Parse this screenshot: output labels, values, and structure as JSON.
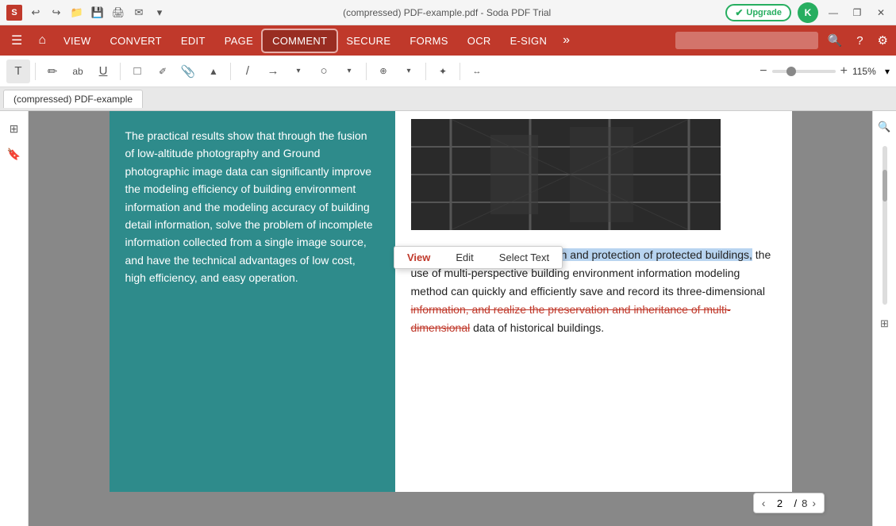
{
  "titlebar": {
    "logo": "S",
    "filename": "(compressed)  PDF-example.pdf  -  Soda PDF Trial",
    "upgrade_label": "Upgrade",
    "avatar_label": "K",
    "controls": [
      "—",
      "❐",
      "✕"
    ]
  },
  "menubar": {
    "items": [
      "VIEW",
      "CONVERT",
      "EDIT",
      "PAGE",
      "COMMENT",
      "SECURE",
      "FORMS",
      "OCR",
      "E-SIGN"
    ],
    "active_index": 4,
    "search_placeholder": ""
  },
  "toolbar": {
    "tools": [
      "T",
      "✏",
      "ab",
      "U",
      "□",
      "✐",
      "📎",
      "▲",
      "/",
      "→",
      "○",
      "→",
      "⊕",
      "→",
      "✦"
    ],
    "zoom_minus": "−",
    "zoom_plus": "+",
    "zoom_value": "115%"
  },
  "tabbar": {
    "tab_label": "(compressed)  PDF-example"
  },
  "context_menu": {
    "items": [
      "View",
      "Edit",
      "Select Text"
    ],
    "active": "View"
  },
  "pdf": {
    "left_col_text": "The practical results show that through the fusion of low-altitude photography and Ground photographic image data can significantly improve the modeling efficiency of building environment information and the modeling accuracy of building detail information, solve the problem of incomplete information collected from a single image source, and have the technical advantages of low cost, high efficiency, and easy operation.",
    "right_highlighted": "In the process of data collection and protection of protected buildings,",
    "right_normal": " the use of multi-perspective building environment information modeling method can quickly and efficiently save and record its three-dimensional information, and realize the preservation and inheritance of multi-dimensional data of historical buildings.",
    "right_strikethrough": "information, and realize the preservation and inheritance of multi-dimensional"
  },
  "page_nav": {
    "prev": "‹",
    "next": "›",
    "current": "2",
    "separator": "/",
    "total": "8"
  }
}
